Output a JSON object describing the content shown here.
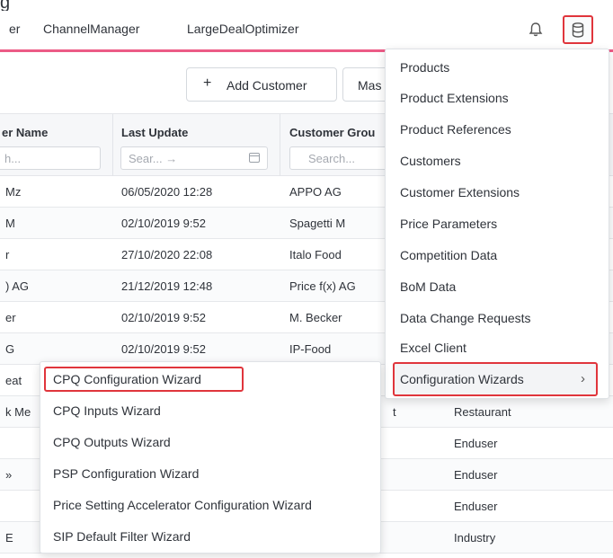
{
  "top_fragment": "g",
  "nav": {
    "tabs": [
      "er",
      "ChannelManager",
      "LargeDealOptimizer"
    ],
    "bell_icon": "bell-icon",
    "db_icon": "database-icon"
  },
  "toolbar": {
    "add_customer": "Add Customer",
    "add_icon": "+",
    "master_partial": "Mas"
  },
  "grid": {
    "columns": [
      {
        "title": "er Name",
        "filter": "h..."
      },
      {
        "title": "Last Update",
        "filter": "Sear... →"
      },
      {
        "title": "Customer Grou",
        "filter": "Search..."
      }
    ],
    "rows": [
      {
        "name": "Mz",
        "updated": "06/05/2020 12:28",
        "group": "APPO AG",
        "type": ""
      },
      {
        "name": "M",
        "updated": "02/10/2019 9:52",
        "group": "Spagetti M",
        "type": ""
      },
      {
        "name": "r",
        "updated": "27/10/2020 22:08",
        "group": "Italo Food",
        "type": ""
      },
      {
        "name": ") AG",
        "updated": "21/12/2019 12:48",
        "group": "Price f(x) AG",
        "type": ""
      },
      {
        "name": "er",
        "updated": "02/10/2019 9:52",
        "group": "M. Becker",
        "type": ""
      },
      {
        "name": "G",
        "updated": "02/10/2019 9:52",
        "group": "IP-Food",
        "type": ""
      },
      {
        "name": "eat",
        "updated": "",
        "group": "",
        "type": ""
      },
      {
        "name": "k Me",
        "updated": "",
        "group": "t",
        "type": "Restaurant"
      },
      {
        "name": "",
        "updated": "",
        "group": "",
        "type": "Enduser"
      },
      {
        "name": "»",
        "updated": "",
        "group": "",
        "type": "Enduser"
      },
      {
        "name": "",
        "updated": "",
        "group": "",
        "type": "Enduser"
      },
      {
        "name": "E",
        "updated": "",
        "group": "",
        "type": "Industry"
      }
    ]
  },
  "master_menu": {
    "items": [
      "Products",
      "Product Extensions",
      "Product References",
      "Customers",
      "Customer Extensions",
      "Price Parameters",
      "Competition Data",
      "BoM Data",
      "Data Change Requests",
      "Excel Client"
    ],
    "active": "Configuration Wizards",
    "chevron": "›"
  },
  "wizard_menu": {
    "active": "CPQ Configuration Wizard",
    "items": [
      "CPQ Inputs Wizard",
      "CPQ Outputs Wizard",
      "PSP Configuration Wizard",
      "Price Setting Accelerator Configuration Wizard",
      "SIP Default Filter Wizard"
    ]
  },
  "colors": {
    "accent_pink": "#ec5b86",
    "highlight_red": "#e0353c"
  }
}
